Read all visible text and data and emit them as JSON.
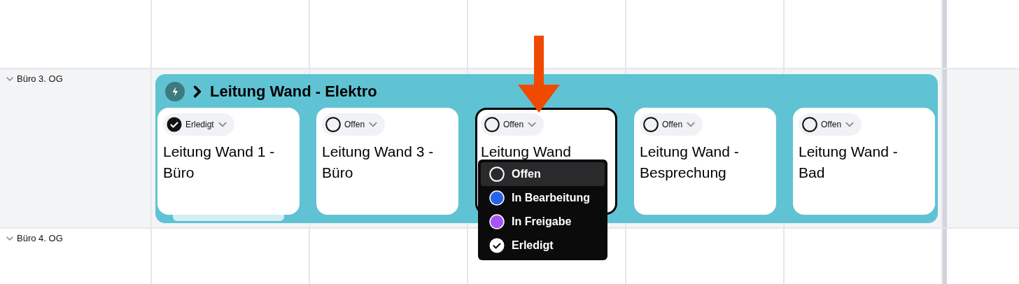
{
  "rows": [
    {
      "label": "Büro 3. OG",
      "expanded": true
    },
    {
      "label": "Büro 4. OG",
      "expanded": true
    }
  ],
  "group": {
    "title": "Leitung Wand - Elektro",
    "cards": [
      {
        "status": "Erledigt",
        "kind": "done",
        "title": "Leitung Wand 1 - Büro",
        "selected": false,
        "stacked": true
      },
      {
        "status": "Offen",
        "kind": "open",
        "title": "Leitung Wand 3 - Büro",
        "selected": false,
        "stacked": false
      },
      {
        "status": "Offen",
        "kind": "open",
        "title": "Leitung Wand",
        "selected": true,
        "stacked": false,
        "menu_open": true
      },
      {
        "status": "Offen",
        "kind": "open",
        "title": "Leitung Wand - Besprechung",
        "selected": false,
        "stacked": false
      },
      {
        "status": "Offen",
        "kind": "open",
        "title": "Leitung Wand - Bad",
        "selected": false,
        "stacked": false
      }
    ]
  },
  "status_menu": {
    "items": [
      {
        "label": "Offen",
        "kind": "open",
        "selected": true
      },
      {
        "label": "In Bearbeitung",
        "kind": "dot",
        "color": "#2563eb",
        "selected": false
      },
      {
        "label": "In Freigabe",
        "kind": "dot",
        "color": "#a855f7",
        "selected": false
      },
      {
        "label": "Erledigt",
        "kind": "done",
        "selected": false
      }
    ]
  }
}
